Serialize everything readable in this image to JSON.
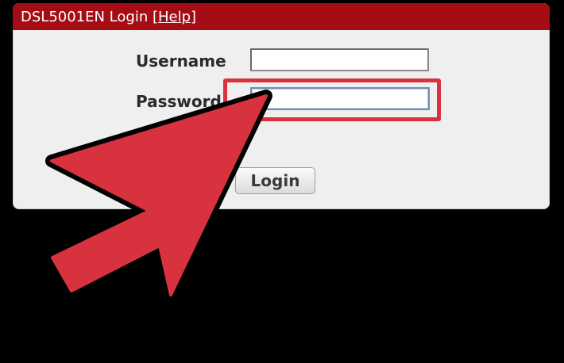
{
  "header": {
    "title": "DSL5001EN Login",
    "help_link": "[Help]"
  },
  "form": {
    "username_label": "Username",
    "username_value": "",
    "password_label": "Password",
    "password_value": "",
    "login_button": "Login"
  },
  "colors": {
    "header_bg": "#a50c13",
    "highlight": "#d8323e",
    "arrow_fill": "#d8323e",
    "page_bg": "#000000"
  },
  "icons": {
    "pointer": "arrow-pointer-icon"
  }
}
